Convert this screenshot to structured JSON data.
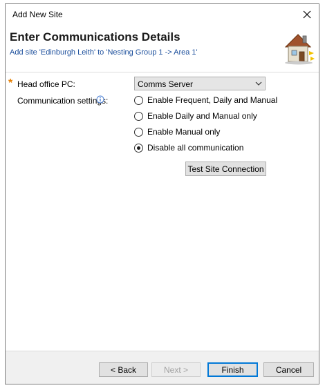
{
  "window": {
    "title": "Add New Site"
  },
  "header": {
    "title": "Enter Communications Details",
    "subtitle": "Add site 'Edinburgh Leith' to 'Nesting Group 1 -> Area 1'"
  },
  "form": {
    "required_marker": "*",
    "head_office_label": "Head office PC:",
    "head_office_value": "Comms Server",
    "comm_settings_label": "Communication settings:",
    "radio_options": [
      {
        "label": "Enable Frequent, Daily and Manual",
        "selected": false
      },
      {
        "label": "Enable Daily and Manual only",
        "selected": false
      },
      {
        "label": "Enable Manual only",
        "selected": false
      },
      {
        "label": "Disable all communication",
        "selected": true
      }
    ],
    "test_button": "Test Site Connection"
  },
  "footer": {
    "back": "< Back",
    "next": "Next >",
    "finish": "Finish",
    "cancel": "Cancel"
  },
  "colors": {
    "accent": "#0078d7",
    "required": "#e67e00",
    "subtitle": "#1c4f9c"
  }
}
